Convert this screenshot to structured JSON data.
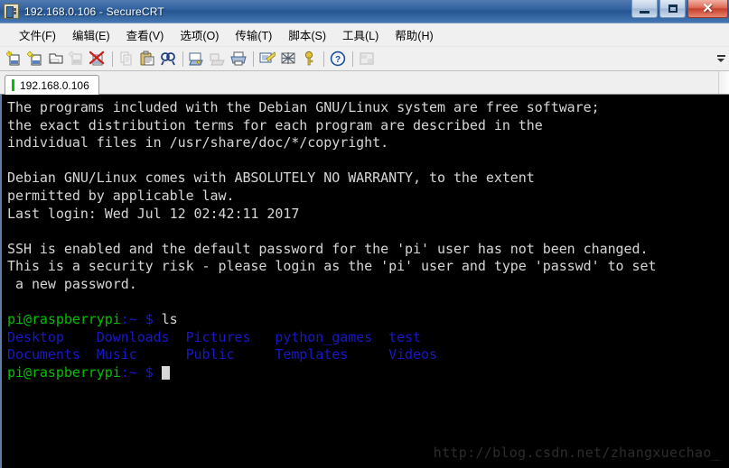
{
  "window": {
    "title": "192.168.0.106 - SecureCRT",
    "icon": "securecrt-app-icon",
    "controls": {
      "minimize": "–",
      "maximize": "□",
      "close": "✕"
    }
  },
  "menubar": {
    "items": [
      {
        "label": "文件(F)",
        "name": "menu-file"
      },
      {
        "label": "编辑(E)",
        "name": "menu-edit"
      },
      {
        "label": "查看(V)",
        "name": "menu-view"
      },
      {
        "label": "选项(O)",
        "name": "menu-options"
      },
      {
        "label": "传输(T)",
        "name": "menu-transfer"
      },
      {
        "label": "脚本(S)",
        "name": "menu-script"
      },
      {
        "label": "工具(L)",
        "name": "menu-tools"
      },
      {
        "label": "帮助(H)",
        "name": "menu-help"
      }
    ]
  },
  "toolbar": {
    "icons": [
      "new-session-icon",
      "new-tab-icon",
      "clone-session-icon",
      "connect-sftp-icon",
      "disconnect-icon",
      "copy-icon",
      "paste-icon",
      "find-icon",
      "print-icon",
      "log-session-icon",
      "printer-icon",
      "session-options-icon",
      "clear-screen-icon",
      "key-icon",
      "help-icon",
      "arrange-windows-icon"
    ],
    "overflow_label": "»"
  },
  "tabs": [
    {
      "label": "192.168.0.106",
      "active": true,
      "status_color": "#00c000"
    }
  ],
  "terminal": {
    "colors": {
      "background": "#000000",
      "foreground": "#d6d6d6",
      "prompt_user": "#00c000",
      "directory": "#1818c8"
    },
    "lines": [
      {
        "segments": [
          {
            "text": "The programs included with the Debian GNU/Linux system are free software;",
            "color": "white"
          }
        ]
      },
      {
        "segments": [
          {
            "text": "the exact distribution terms for each program are described in the",
            "color": "white"
          }
        ]
      },
      {
        "segments": [
          {
            "text": "individual files in /usr/share/doc/*/copyright.",
            "color": "white"
          }
        ]
      },
      {
        "segments": [
          {
            "text": "",
            "color": "white"
          }
        ]
      },
      {
        "segments": [
          {
            "text": "Debian GNU/Linux comes with ABSOLUTELY NO WARRANTY, to the extent",
            "color": "white"
          }
        ]
      },
      {
        "segments": [
          {
            "text": "permitted by applicable law.",
            "color": "white"
          }
        ]
      },
      {
        "segments": [
          {
            "text": "Last login: Wed Jul 12 02:42:11 2017",
            "color": "white"
          }
        ]
      },
      {
        "segments": [
          {
            "text": "",
            "color": "white"
          }
        ]
      },
      {
        "segments": [
          {
            "text": "SSH is enabled and the default password for the 'pi' user has not been changed.",
            "color": "white"
          }
        ]
      },
      {
        "segments": [
          {
            "text": "This is a security risk - please login as the 'pi' user and type 'passwd' to set",
            "color": "white"
          }
        ]
      },
      {
        "segments": [
          {
            "text": " a new password.",
            "color": "white"
          }
        ]
      },
      {
        "segments": [
          {
            "text": "",
            "color": "white"
          }
        ]
      },
      {
        "segments": [
          {
            "text": "pi@raspberrypi",
            "color": "green"
          },
          {
            "text": ":",
            "color": "blue"
          },
          {
            "text": "~",
            "color": "blue"
          },
          {
            "text": " ",
            "color": "white"
          },
          {
            "text": "$",
            "color": "blue"
          },
          {
            "text": " ls",
            "color": "white"
          }
        ]
      },
      {
        "segments": [
          {
            "text": "Desktop    Downloads  Pictures   python_games  test",
            "color": "blue"
          }
        ]
      },
      {
        "segments": [
          {
            "text": "Documents  Music      Public     Templates     Videos",
            "color": "blue"
          }
        ]
      },
      {
        "segments": [
          {
            "text": "pi@raspberrypi",
            "color": "green"
          },
          {
            "text": ":",
            "color": "blue"
          },
          {
            "text": "~",
            "color": "blue"
          },
          {
            "text": " ",
            "color": "white"
          },
          {
            "text": "$",
            "color": "blue"
          },
          {
            "text": " ",
            "color": "white"
          },
          {
            "text": "",
            "color": "cursor"
          }
        ]
      }
    ],
    "watermark": "http://blog.csdn.net/zhangxuechao_"
  }
}
